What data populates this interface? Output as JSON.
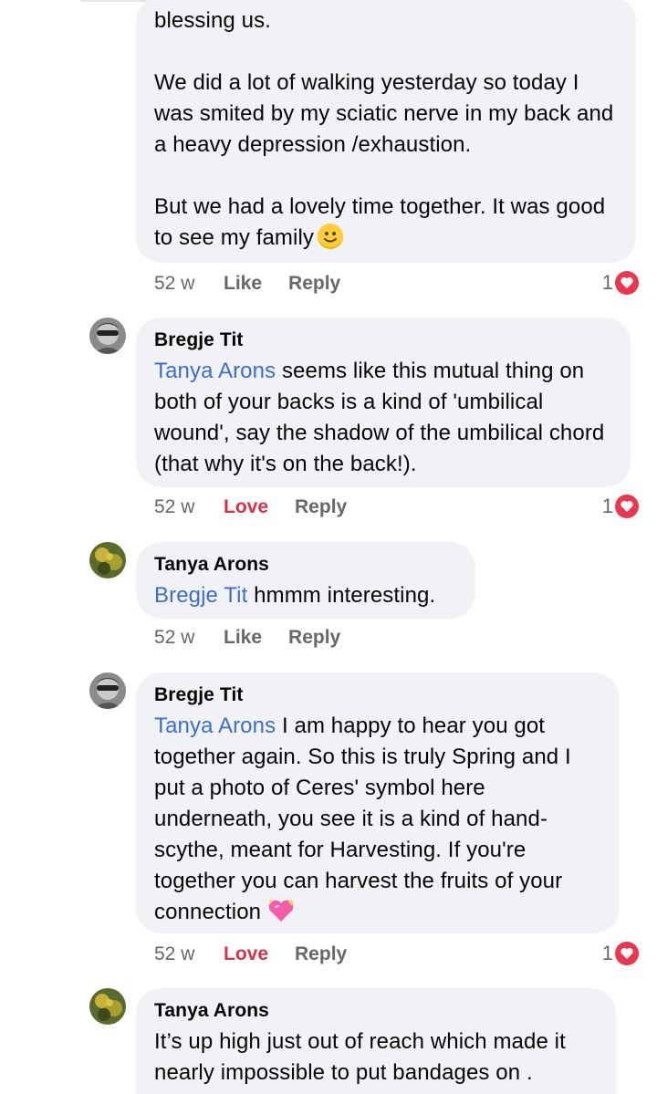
{
  "comments": [
    {
      "id": "c1",
      "paragraphs": [
        "blessing us.",
        "We did a lot of walking yesterday so today I was smited by my sciatic nerve in my back and a heavy depression /exhaustion.",
        "But we had a lovely time together.  It was good to see my family"
      ],
      "time": "52 w",
      "action1": "Like",
      "action2": "Reply",
      "reaction_count": "1"
    },
    {
      "id": "c2",
      "author": "Bregje Tit",
      "mention": "Tanya Arons",
      "text": " seems like this mutual thing on both of your backs is a kind of 'umbilical wound', say the shadow of the umbilical chord (that why it's on the back!).",
      "time": "52 w",
      "action1": "Love",
      "action2": "Reply",
      "reaction_count": "1"
    },
    {
      "id": "c3",
      "author": "Tanya Arons",
      "mention": "Bregje Tit",
      "text": " hmmm interesting.",
      "time": "52 w",
      "action1": "Like",
      "action2": "Reply"
    },
    {
      "id": "c4",
      "author": "Bregje Tit",
      "mention": "Tanya Arons",
      "text": " I am happy to hear you got together again. So this is truly Spring and I put a photo of Ceres' symbol here underneath, you see it is a kind of hand-scythe, meant for Harvesting. If you're together you can harvest the fruits of your connection",
      "time": "52 w",
      "action1": "Love",
      "action2": "Reply",
      "reaction_count": "1"
    },
    {
      "id": "c5",
      "author": "Tanya Arons",
      "text": "It’s up high just out of reach which made it nearly impossible to put bandages on ."
    }
  ],
  "colors": {
    "bubble": "#f0f2f5",
    "mention": "#3e6ec7",
    "love": "#d6334a",
    "meta": "#65676b",
    "heart": "#e8384f"
  },
  "icons": [
    "smile-emoji-icon",
    "sparkling-heart-emoji-icon",
    "heart-reaction-icon"
  ]
}
